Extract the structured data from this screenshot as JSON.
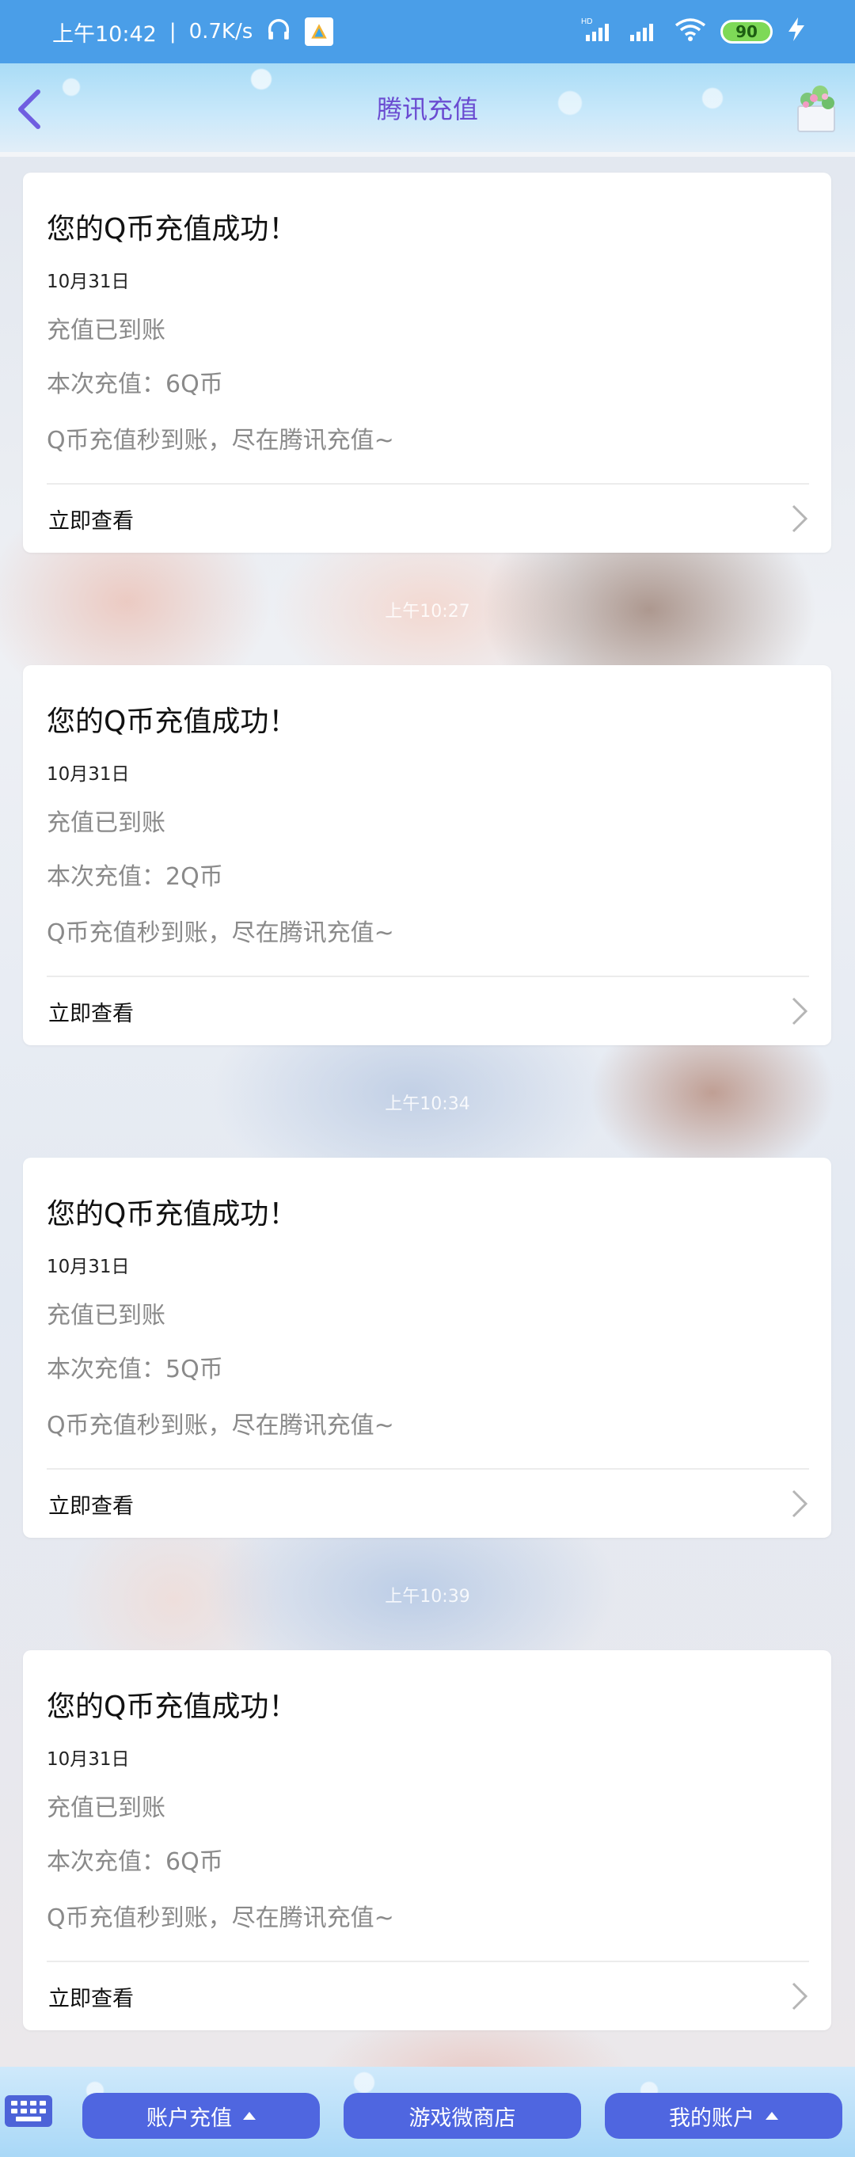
{
  "status_bar": {
    "time": "上午10:42",
    "separator": "|",
    "speed": "0.7K/s",
    "network_label": "HD",
    "battery": "90"
  },
  "header": {
    "title": "腾讯充值"
  },
  "messages": [
    {
      "title": "您的Q币充值成功！",
      "date": "10月31日",
      "line1": "充值已到账",
      "line2": "本次充值：6Q币",
      "line3": "Q币充值秒到账，尽在腾讯充值~",
      "link": "立即查看"
    },
    {
      "timestamp": "上午10:27",
      "title": "您的Q币充值成功！",
      "date": "10月31日",
      "line1": "充值已到账",
      "line2": "本次充值：2Q币",
      "line3": "Q币充值秒到账，尽在腾讯充值~",
      "link": "立即查看"
    },
    {
      "timestamp": "上午10:34",
      "title": "您的Q币充值成功！",
      "date": "10月31日",
      "line1": "充值已到账",
      "line2": "本次充值：5Q币",
      "line3": "Q币充值秒到账，尽在腾讯充值~",
      "link": "立即查看"
    },
    {
      "timestamp": "上午10:39",
      "title": "您的Q币充值成功！",
      "date": "10月31日",
      "line1": "充值已到账",
      "line2": "本次充值：6Q币",
      "line3": "Q币充值秒到账，尽在腾讯充值~",
      "link": "立即查看"
    }
  ],
  "bottom_menu": {
    "items": [
      "账户充值",
      "游戏微商店",
      "我的账户"
    ]
  },
  "colors": {
    "status_bar": "#4a9ee8",
    "title_accent": "#6a4bd1",
    "menu_button": "#4f66e0"
  }
}
